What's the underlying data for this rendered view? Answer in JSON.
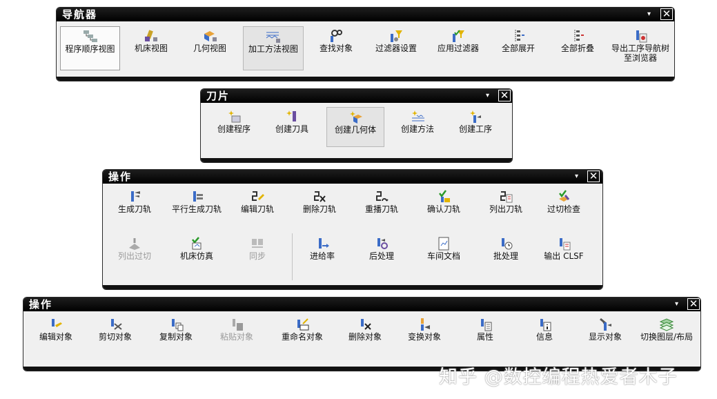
{
  "navigator": {
    "title": "导航器",
    "dropdown": "▾",
    "close": "✕",
    "buttons": [
      {
        "label": "程序顺序视图",
        "icon": "program-order-view-icon"
      },
      {
        "label": "机床视图",
        "icon": "machine-view-icon"
      },
      {
        "label": "几何视图",
        "icon": "geometry-view-icon"
      },
      {
        "label": "加工方法视图",
        "icon": "machining-method-view-icon"
      },
      {
        "label": "查找对象",
        "icon": "find-object-icon"
      },
      {
        "label": "过滤器设置",
        "icon": "filter-settings-icon"
      },
      {
        "label": "应用过滤器",
        "icon": "apply-filter-icon"
      },
      {
        "label": "全部展开",
        "icon": "expand-all-icon"
      },
      {
        "label": "全部折叠",
        "icon": "collapse-all-icon"
      },
      {
        "label": "导出工序导航树至浏览器",
        "icon": "export-to-browser-icon"
      }
    ]
  },
  "insert": {
    "title": "刀片",
    "dropdown": "▾",
    "close": "✕",
    "buttons": [
      {
        "label": "创建程序",
        "icon": "create-program-icon"
      },
      {
        "label": "创建刀具",
        "icon": "create-tool-icon"
      },
      {
        "label": "创建几何体",
        "icon": "create-geometry-icon"
      },
      {
        "label": "创建方法",
        "icon": "create-method-icon"
      },
      {
        "label": "创建工序",
        "icon": "create-operation-icon"
      }
    ]
  },
  "operations": {
    "title": "操作",
    "dropdown": "▾",
    "close": "✕",
    "row1": [
      {
        "label": "生成刀轨",
        "icon": "generate-toolpath-icon"
      },
      {
        "label": "平行生成刀轨",
        "icon": "parallel-generate-toolpath-icon"
      },
      {
        "label": "编辑刀轨",
        "icon": "edit-toolpath-icon"
      },
      {
        "label": "删除刀轨",
        "icon": "delete-toolpath-icon"
      },
      {
        "label": "重播刀轨",
        "icon": "replay-toolpath-icon"
      },
      {
        "label": "确认刀轨",
        "icon": "verify-toolpath-icon"
      },
      {
        "label": "列出刀轨",
        "icon": "list-toolpath-icon"
      },
      {
        "label": "过切检查",
        "icon": "gouge-check-icon"
      }
    ],
    "row2": [
      {
        "label": "列出过切",
        "icon": "list-gouges-icon",
        "disabled": true
      },
      {
        "label": "机床仿真",
        "icon": "machine-simulation-icon"
      },
      {
        "label": "同步",
        "icon": "synchronize-icon",
        "disabled": true
      },
      {
        "label": "进给率",
        "icon": "feed-rate-icon"
      },
      {
        "label": "后处理",
        "icon": "post-process-icon"
      },
      {
        "label": "车间文档",
        "icon": "shop-documentation-icon"
      },
      {
        "label": "批处理",
        "icon": "batch-process-icon"
      },
      {
        "label": "输出 CLSF",
        "icon": "output-clsf-icon"
      }
    ]
  },
  "objects": {
    "title": "操作",
    "dropdown": "▾",
    "close": "✕",
    "buttons": [
      {
        "label": "编辑对象",
        "icon": "edit-object-icon"
      },
      {
        "label": "剪切对象",
        "icon": "cut-object-icon"
      },
      {
        "label": "复制对象",
        "icon": "copy-object-icon"
      },
      {
        "label": "粘贴对象",
        "icon": "paste-object-icon",
        "disabled": true
      },
      {
        "label": "重命名对象",
        "icon": "rename-object-icon"
      },
      {
        "label": "删除对象",
        "icon": "delete-object-icon"
      },
      {
        "label": "变换对象",
        "icon": "transform-object-icon"
      },
      {
        "label": "属性",
        "icon": "properties-icon"
      },
      {
        "label": "信息",
        "icon": "information-icon"
      },
      {
        "label": "显示对象",
        "icon": "show-object-icon"
      },
      {
        "label": "切换图层/布局",
        "icon": "switch-layer-layout-icon"
      }
    ]
  },
  "watermark": "知乎 @数控编程热爱者木子"
}
